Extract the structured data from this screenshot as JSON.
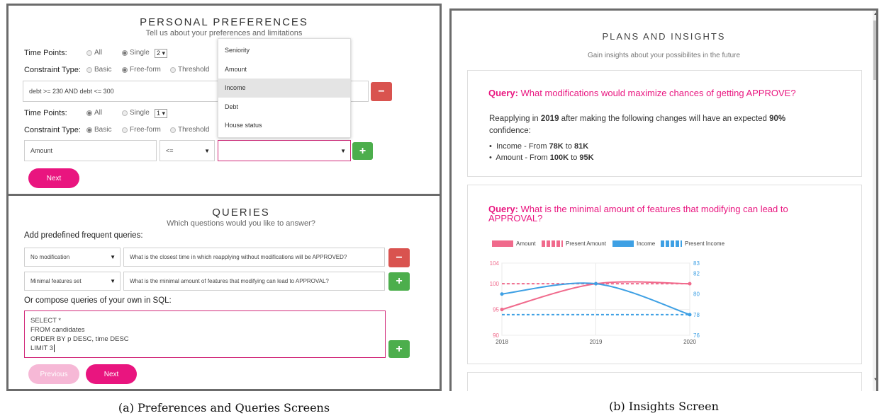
{
  "preferences": {
    "title": "PERSONAL PREFERENCES",
    "subtitle": "Tell us about your preferences and limitations",
    "row1": {
      "time_points_label": "Time Points:",
      "opt_all": "All",
      "opt_single": "Single",
      "single_value": "2",
      "selected": "single",
      "constraint_type_label": "Constraint Type:",
      "opt_basic": "Basic",
      "opt_freeform": "Free-form",
      "opt_threshold": "Threshold",
      "constraint_selected": "freeform",
      "expression": "debt >= 230 AND debt <= 300"
    },
    "row2": {
      "time_points_label": "Time Points:",
      "opt_all": "All",
      "opt_single": "Single",
      "single_value": "1",
      "selected": "all",
      "constraint_type_label": "Constraint Type:",
      "opt_basic": "Basic",
      "opt_freeform": "Free-form",
      "opt_threshold": "Threshold",
      "constraint_selected": "basic",
      "feature": "Amount",
      "operator": "<=",
      "value": ""
    },
    "dropdown_options": [
      "Seniority",
      "Amount",
      "Income",
      "Debt",
      "House status"
    ],
    "dropdown_highlighted": "Income",
    "next_label": "Next",
    "remove_icon": "minus-icon",
    "add_icon": "plus-icon"
  },
  "queries": {
    "title": "QUERIES",
    "subtitle": "Which questions would you like to answer?",
    "predefined_label": "Add predefined frequent queries:",
    "rows": [
      {
        "type": "No modification",
        "question": "What is the closest time in which reapplying without modifications will be APPROVED?"
      },
      {
        "type": "Minimal features set",
        "question": "What is the minimal amount of features that modifying can lead to APPROVAL?"
      }
    ],
    "sql_label": "Or compose queries of your own in SQL:",
    "sql_lines": [
      "SELECT *",
      "FROM candidates",
      "ORDER BY p DESC, time DESC",
      "LIMIT 3"
    ],
    "previous_label": "Previous",
    "next_label": "Next"
  },
  "insights": {
    "title": "PLANS AND INSIGHTS",
    "subtitle": "Gain insights about your possibilites in the future",
    "card1": {
      "query_prefix": "Query:",
      "query_text": "What modifications would maximize chances of getting APPROVE?",
      "body_pre": "Reapplying in ",
      "body_year": "2019",
      "body_mid": " after making the following changes will have an expected ",
      "body_conf": "90%",
      "body_post": "confidence:",
      "bullets": [
        {
          "feature": "Income",
          "sep": " - From ",
          "from": "78K",
          "to_word": " to ",
          "to": "81K"
        },
        {
          "feature": "Amount",
          "sep": " - From ",
          "from": "100K",
          "to_word": " to ",
          "to": "95K"
        }
      ]
    },
    "card2": {
      "query_prefix": "Query:",
      "query_line1": "What is the minimal amount of features that modifying can lead to",
      "query_line2": "APPROVAL?"
    }
  },
  "captions": {
    "a": "(a) Preferences and Queries Screens",
    "b": "(b) Insights Screen"
  },
  "colors": {
    "accent_pink": "#e9157f",
    "amount_series": "#f06a8c",
    "income_series": "#3ea0e4",
    "remove_red": "#d9534f",
    "add_green": "#4cae4c"
  },
  "chart_data": {
    "type": "line",
    "x": [
      "2018",
      "2019",
      "2020"
    ],
    "series": [
      {
        "name": "Amount",
        "axis": "left",
        "values": [
          95,
          100,
          100
        ],
        "style": "solid",
        "color": "#f06a8c"
      },
      {
        "name": "Present Amount",
        "axis": "left",
        "values": [
          100,
          100,
          100
        ],
        "style": "dashed",
        "color": "#f06a8c"
      },
      {
        "name": "Income",
        "axis": "right",
        "values": [
          80,
          81,
          78
        ],
        "style": "solid",
        "color": "#3ea0e4"
      },
      {
        "name": "Present Income",
        "axis": "right",
        "values": [
          78,
          78,
          78
        ],
        "style": "dashed",
        "color": "#3ea0e4"
      }
    ],
    "y_left": {
      "ticks": [
        104,
        100,
        95,
        90
      ],
      "ylim": [
        90,
        104
      ]
    },
    "y_right": {
      "ticks": [
        83,
        82,
        80,
        78,
        76
      ],
      "ylim": [
        76,
        83
      ]
    },
    "legend_position": "top",
    "grid": true,
    "title": "",
    "xlabel": "",
    "ylabel": ""
  }
}
